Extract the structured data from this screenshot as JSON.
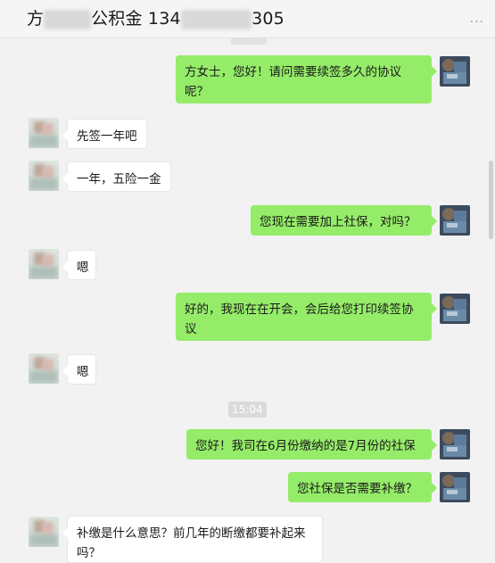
{
  "header": {
    "title_part1": "方",
    "title_part2": "公积金 134",
    "title_part3": "305",
    "more_label": "···"
  },
  "timestamp": "15:04",
  "messages": [
    {
      "side": "self",
      "text": "方女士，您好！请问需要续签多久的协议呢？"
    },
    {
      "side": "other",
      "text": "先签一年吧"
    },
    {
      "side": "other",
      "text": "一年，五险一金"
    },
    {
      "side": "self",
      "text": "您现在需要加上社保，对吗？"
    },
    {
      "side": "other",
      "text": "嗯"
    },
    {
      "side": "self",
      "text": "好的，我现在在开会，会后给您打印续签协议"
    },
    {
      "side": "other",
      "text": "嗯"
    },
    {
      "side": "self",
      "text": "您好！我司在6月份缴纳的是7月份的社保"
    },
    {
      "side": "self",
      "text": "您社保是否需要补缴？"
    },
    {
      "side": "other",
      "text": "补缴是什么意思？前几年的断缴都要补起来吗？"
    }
  ]
}
